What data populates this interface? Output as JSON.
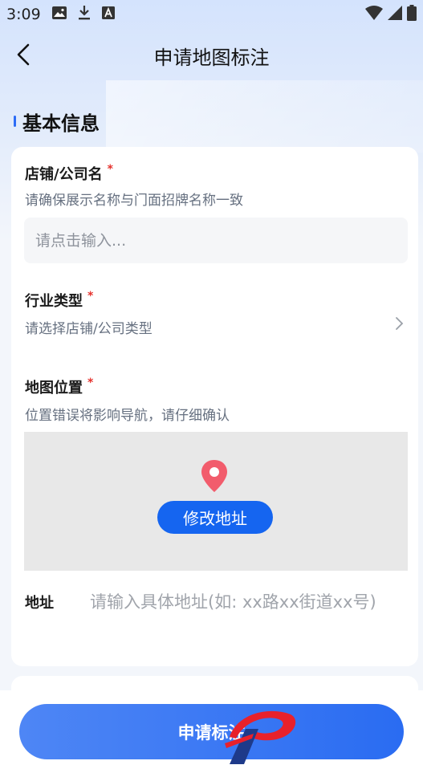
{
  "status_bar": {
    "time": "3:09",
    "icons": [
      "image-icon",
      "download-icon",
      "font-icon",
      "wifi-icon",
      "signal-icon",
      "battery-icon"
    ]
  },
  "nav": {
    "title": "申请地图标注",
    "back_icon": "chevron-left-icon"
  },
  "section": {
    "title": "基本信息",
    "accent_color": "#2c6cf6"
  },
  "form": {
    "shop_name": {
      "label": "店铺/公司名",
      "required_mark": "*",
      "hint": "请确保展示名称与门面招牌名称一致",
      "placeholder": "请点击输入..."
    },
    "industry": {
      "label": "行业类型",
      "required_mark": "*",
      "hint": "请选择店铺/公司类型"
    },
    "location": {
      "label": "地图位置",
      "required_mark": "*",
      "hint": "位置错误将影响导航，请仔细确认",
      "edit_button": "修改地址"
    },
    "address": {
      "label": "地址",
      "placeholder": "请输入具体地址(如: xx路xx街道xx号)"
    }
  },
  "submit": {
    "label": "申请标注",
    "color": "#2a6cf2"
  },
  "logo": {
    "icon": "brand-logo-icon",
    "colors": [
      "#e8212b",
      "#1e3a8a"
    ]
  }
}
